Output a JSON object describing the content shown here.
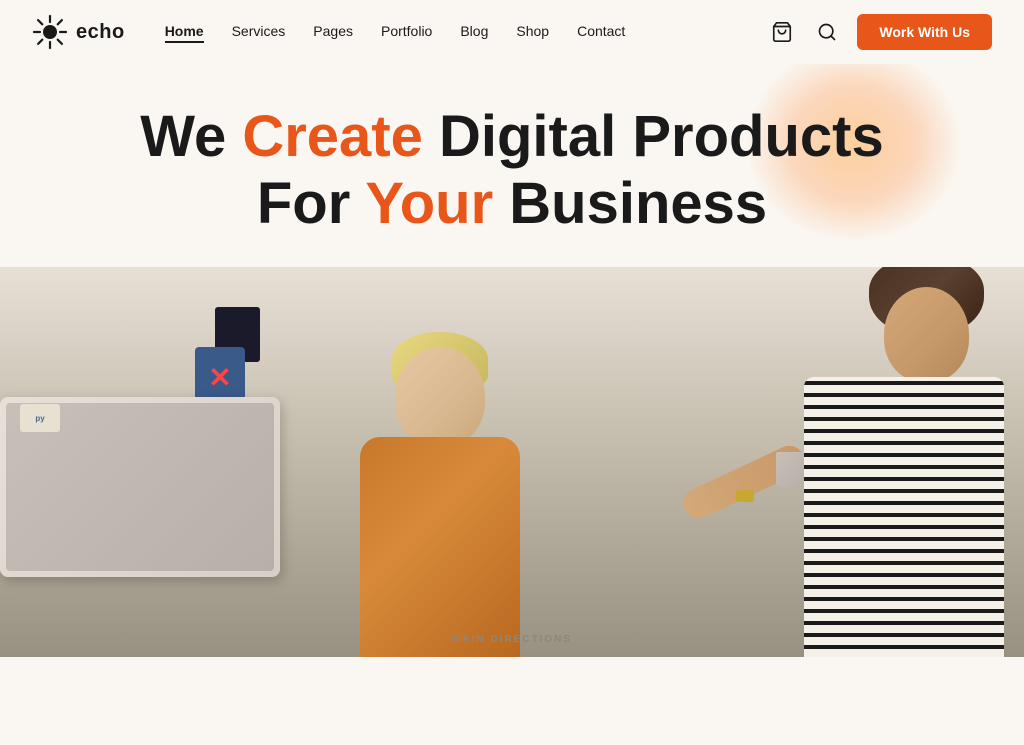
{
  "logo": {
    "text": "echo"
  },
  "navbar": {
    "links": [
      {
        "label": "Home",
        "active": true
      },
      {
        "label": "Services",
        "active": false
      },
      {
        "label": "Pages",
        "active": false
      },
      {
        "label": "Portfolio",
        "active": false
      },
      {
        "label": "Blog",
        "active": false
      },
      {
        "label": "Shop",
        "active": false
      },
      {
        "label": "Contact",
        "active": false
      }
    ],
    "cta_label": "Work With Us"
  },
  "hero": {
    "line1_prefix": "We ",
    "line1_highlight": "Create",
    "line1_suffix": " Digital Products",
    "line2_prefix": "For ",
    "line2_highlight": "Your",
    "line2_suffix": " Business"
  },
  "footer": {
    "section_label": "MAIN DIRECTIONS"
  }
}
